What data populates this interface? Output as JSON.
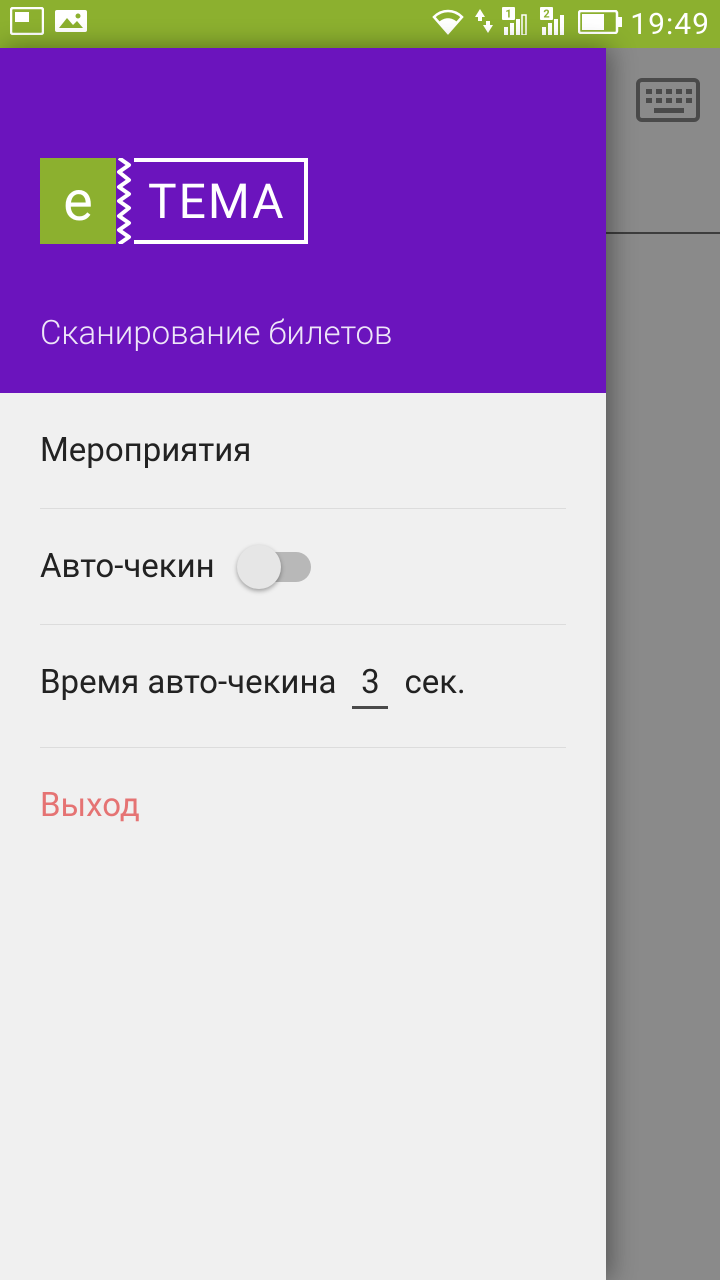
{
  "status": {
    "time": "19:49"
  },
  "drawer": {
    "logo_e": "e",
    "logo_tema": "TEMA",
    "title": "Сканирование билетов",
    "menu": {
      "events": "Мероприятия",
      "auto_checkin": "Авто-чекин",
      "auto_checkin_enabled": false,
      "time_label": "Время авто-чекина",
      "time_value": "3",
      "time_unit": "сек.",
      "exit": "Выход"
    }
  }
}
